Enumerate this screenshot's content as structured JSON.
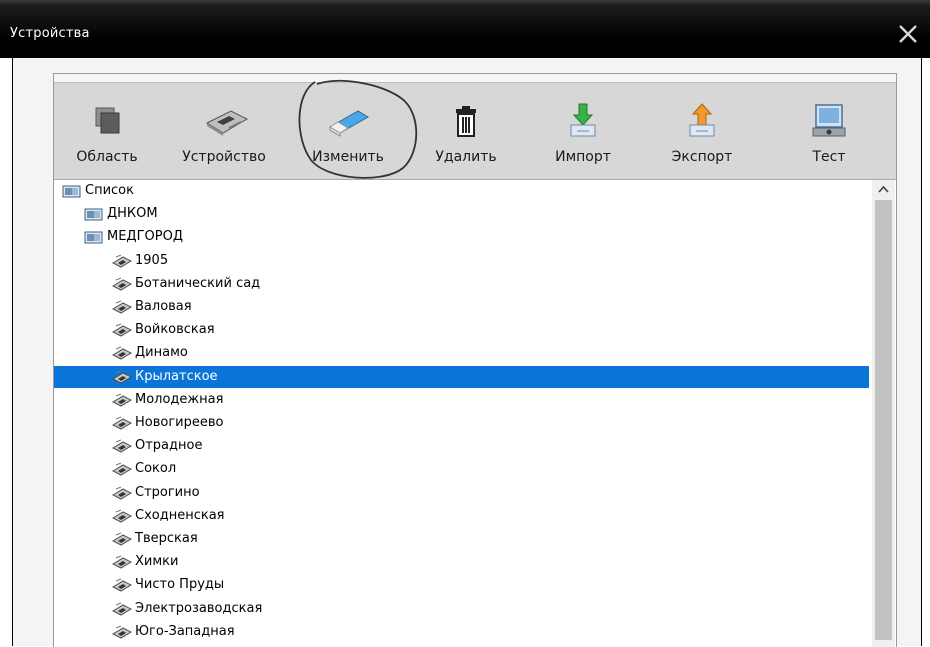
{
  "window": {
    "title": "Устройства",
    "close_icon": "close-icon"
  },
  "toolbar": [
    {
      "id": "area",
      "label": "Область",
      "icon": "area-icon"
    },
    {
      "id": "device",
      "label": "Устройство",
      "icon": "device-card-icon"
    },
    {
      "id": "edit",
      "label": "Изменить",
      "icon": "eraser-icon"
    },
    {
      "id": "delete",
      "label": "Удалить",
      "icon": "trash-icon"
    },
    {
      "id": "import",
      "label": "Импорт",
      "icon": "import-icon"
    },
    {
      "id": "export",
      "label": "Экспорт",
      "icon": "export-icon"
    },
    {
      "id": "test",
      "label": "Тест",
      "icon": "network-test-icon"
    }
  ],
  "tree": {
    "root": "Список",
    "groups": [
      {
        "name": "ДНКОМ",
        "items": []
      },
      {
        "name": "МЕДГОРОД",
        "items": [
          "1905",
          "Ботанический сад",
          "Валовая",
          "Войковская",
          "Динамо",
          "Крылатское",
          "Молодежная",
          "Новогиреево",
          "Отрадное",
          "Сокол",
          "Строгино",
          "Сходненская",
          "Тверская",
          "Химки",
          "Чисто Пруды",
          "Электрозаводская",
          "Юго-Западная"
        ]
      }
    ],
    "selected": "Крылатское"
  },
  "colors": {
    "selection": "#0a74d7",
    "toolbar": "#d7d7d7",
    "titlebar": "#000000"
  }
}
